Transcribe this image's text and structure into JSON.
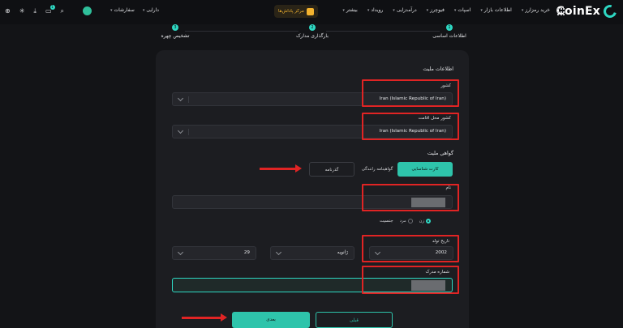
{
  "brand": {
    "name": "CoinEx"
  },
  "nav": {
    "items": [
      "خرید رمزارز",
      "اطلاعات بازار",
      "اسپات",
      "فیوچرز",
      "درآمدزایی",
      "رویداد",
      "بیشتر"
    ],
    "promo": "مرکز پاداش‌ها",
    "assets": "دارایی",
    "orders": "سفارشات",
    "notification_count": "1"
  },
  "steps": [
    {
      "index": "1",
      "label": "اطلاعات اساسی"
    },
    {
      "index": "2",
      "label": "بارگذاری مدارک"
    },
    {
      "index": "3",
      "label": "تشخیص چهره"
    }
  ],
  "form": {
    "nationality_title": "اطلاعات ملیت",
    "country_label": "کشور",
    "country_value": "Iran (Islamic Republic of Iran)",
    "residence_label": "کشور محل اقامت",
    "residence_value": "Iran (Islamic Republic of Iran)",
    "certificate_title": "گواهی ملیت",
    "tabs": [
      "کارت شناسایی",
      "گواهینامه رانندگی",
      "گذرنامه"
    ],
    "name_label": "نام",
    "gender_label": "جنسیت",
    "gender_options": [
      "زن",
      "مرد"
    ],
    "birth_label": "تاریخ تولد",
    "birth_year": "2002",
    "birth_month": "ژانویه",
    "birth_day": "29",
    "doc_number_label": "شماره مدرک",
    "next_button": "بعدی",
    "prev_button": "قبلی"
  },
  "colors": {
    "accent": "#2ec4ab",
    "annotation": "#e02424",
    "background": "#131417",
    "card": "#1c1d21"
  }
}
